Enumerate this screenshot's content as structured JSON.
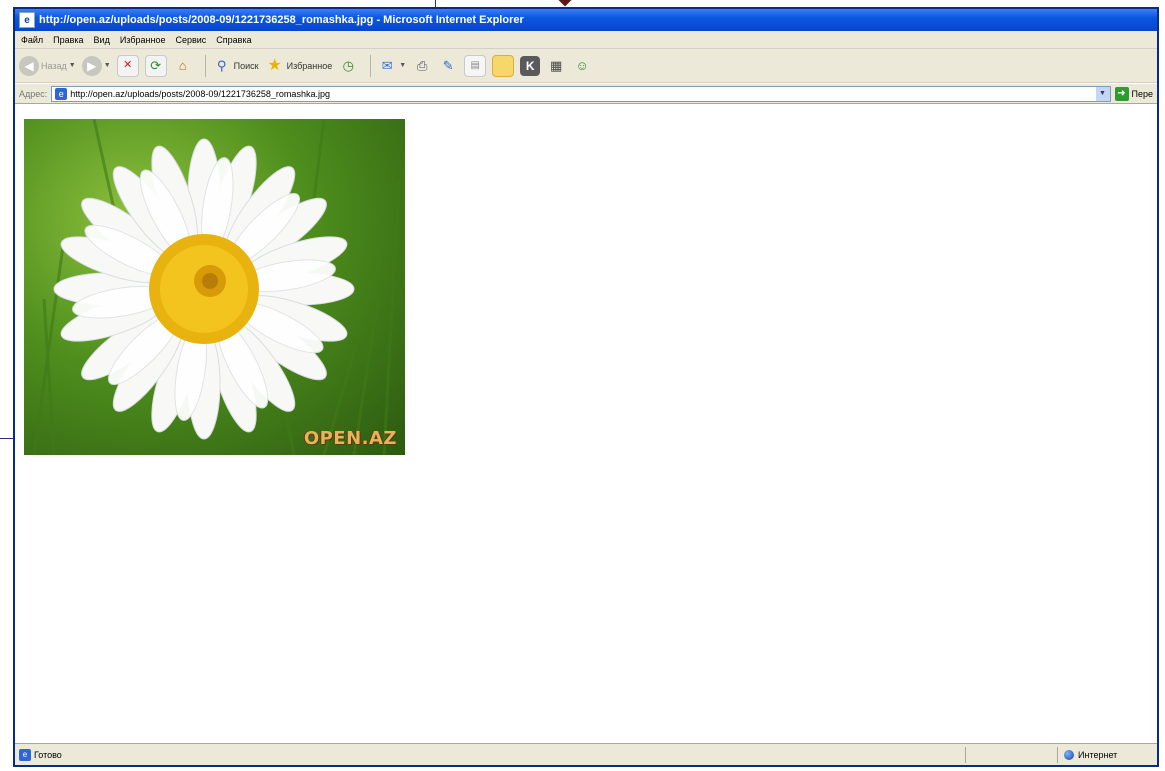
{
  "window": {
    "title": "http://open.az/uploads/posts/2008-09/1221736258_romashka.jpg - Microsoft Internet Explorer"
  },
  "menu": {
    "items": [
      "Файл",
      "Правка",
      "Вид",
      "Избранное",
      "Сервис",
      "Справка"
    ]
  },
  "toolbar": {
    "back_label": "Назад",
    "search_label": "Поиск",
    "favorites_label": "Избранное"
  },
  "address": {
    "label": "Адрес:",
    "url": "http://open.az/uploads/posts/2008-09/1221736258_romashka.jpg",
    "go_label": "Пере"
  },
  "image": {
    "watermark": "OPEN.AZ"
  },
  "status": {
    "text": "Готово",
    "zone": "Интернет"
  },
  "colors": {
    "titlebar": "#0b57e0",
    "chrome": "#ece9d8",
    "window_border": "#0a2a8a"
  }
}
